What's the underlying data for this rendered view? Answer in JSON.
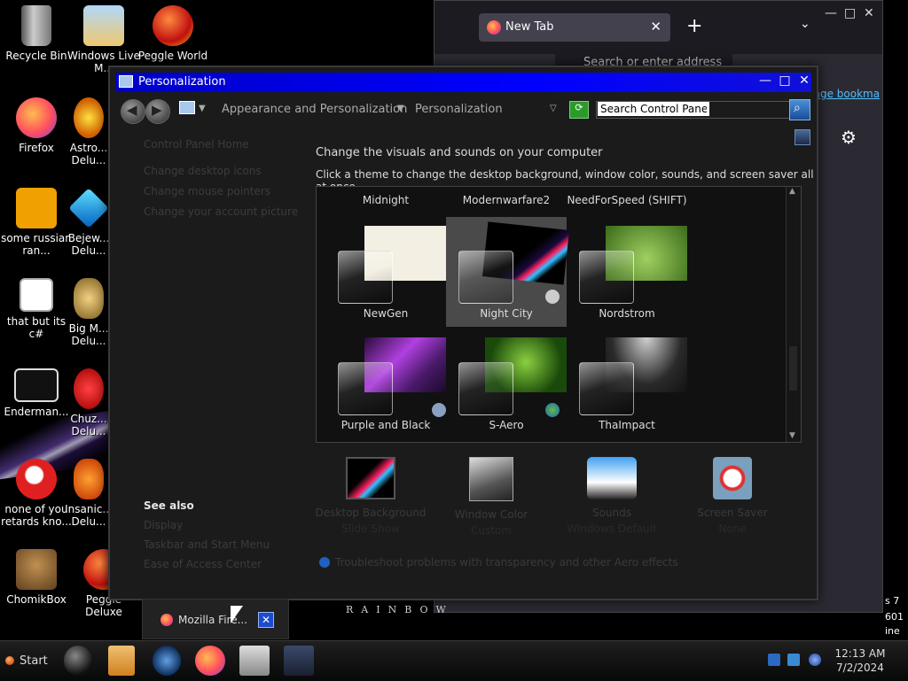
{
  "desktop": {
    "icons": [
      {
        "label": "Recycle Bin"
      },
      {
        "label": "Windows Live M..."
      },
      {
        "label": "Peggle World"
      },
      {
        "label": "Firefox"
      },
      {
        "label": "Astro... Delu..."
      },
      {
        "label": "some russian ran..."
      },
      {
        "label": "Bejew... Delu..."
      },
      {
        "label": "that but its c#"
      },
      {
        "label": "Big M... Delu..."
      },
      {
        "label": "Enderman..."
      },
      {
        "label": "Chuz... Delu..."
      },
      {
        "label": "none of you retards kno..."
      },
      {
        "label": "Insanic... Delu..."
      },
      {
        "label": "ChomikBox"
      },
      {
        "label": "Peggle Deluxe"
      }
    ]
  },
  "browser": {
    "tab_title": "New Tab",
    "address_placeholder": "Search or enter address",
    "bookmark_text": "nage bookma"
  },
  "window": {
    "title": "Personalization",
    "breadcrumb": [
      "Appearance and Personalization",
      "Personalization"
    ],
    "search_placeholder": "Search Control Panel",
    "left_links": [
      "Control Panel Home",
      "Change desktop icons",
      "Change mouse pointers",
      "Change your account picture"
    ],
    "see_also_heading": "See also",
    "see_also_links": [
      "Display",
      "Taskbar and Start Menu",
      "Ease of Access Center"
    ],
    "heading": "Change the visuals and sounds on your computer",
    "subheading": "Click a theme to change the desktop background, window color, sounds, and screen saver all at once.",
    "themes_partial": [
      "Midnight",
      "Modernwarfare2",
      "NeedForSpeed (SHIFT)"
    ],
    "themes": [
      {
        "name": "NewGen",
        "bg": "#f3efe2",
        "selected": false
      },
      {
        "name": "Night City",
        "bg": "#050505",
        "selected": true
      },
      {
        "name": "Nordstrom",
        "bg": "#5a8a2a",
        "selected": false
      },
      {
        "name": "Purple and Black",
        "bg": "#6a2a8a",
        "selected": false
      },
      {
        "name": "S-Aero",
        "bg": "#3a6a1a",
        "selected": false
      },
      {
        "name": "ThaImpact",
        "bg": "#2a2a2a",
        "selected": false
      }
    ],
    "bottom_items": [
      {
        "label": "Desktop Background",
        "sub": "Slide Show"
      },
      {
        "label": "Window Color",
        "sub": "Custom"
      },
      {
        "label": "Sounds",
        "sub": "Windows Default"
      },
      {
        "label": "Screen Saver",
        "sub": "None"
      }
    ],
    "troubleshoot": "Troubleshoot problems with transparency and other Aero effects"
  },
  "taskbar": {
    "start_label": "Start",
    "preview_title": "Mozilla Fire...",
    "preview_close": "✕",
    "time": "12:13 AM",
    "date": "7/2/2024"
  },
  "edge_text": [
    "s 7",
    "601",
    "ine"
  ],
  "wallpaper_text": "RAINBOW",
  "colors": {
    "title_bar": "#0000ff",
    "selected_theme": "#4a4a4a"
  }
}
